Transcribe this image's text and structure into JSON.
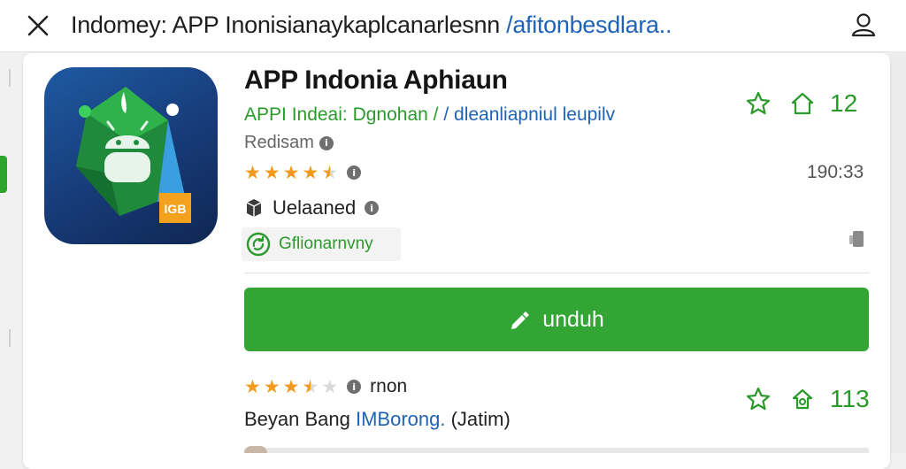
{
  "topbar": {
    "title": "Indomey: APP Inonisianaykaplcanarlesnn ",
    "title_link": "/afitonbesdlara..",
    "close_icon": "close-icon",
    "profile_icon": "profile-icon"
  },
  "app": {
    "name": "APP Indonia Aphiaun",
    "subtitle": "APPI Indeai: Dgnohan /",
    "subtitle_link": "/ dleanliapniul leupilv",
    "developer": "Redisam",
    "rating_stars": 4.5,
    "time": "190:33",
    "status": "Uelaaned",
    "tag": "Gflionarnvny",
    "icon_badge": "IGB",
    "favorite_count": "12",
    "colors": {
      "accent": "#33a534",
      "link": "#1d63b8",
      "star": "#f29a1d"
    }
  },
  "actions": {
    "download_label": "unduh"
  },
  "review": {
    "rating_stars": 3.5,
    "label": "rnon",
    "author_prefix": "Beyan Bang ",
    "author_link": "IMBorong.",
    "author_suffix": " (Jatim)",
    "count": "113"
  }
}
